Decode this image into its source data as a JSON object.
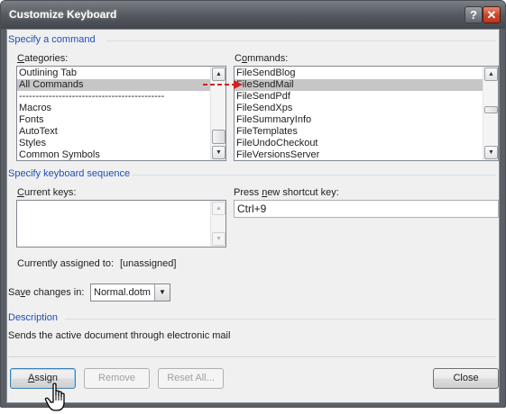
{
  "window": {
    "title": "Customize Keyboard",
    "help_label": "?",
    "close_label": "✕"
  },
  "specify_command": {
    "header": "Specify a command",
    "categories_label_pre": "",
    "categories_label_key": "C",
    "categories_label_post": "ategories:",
    "categories": [
      "Outlining Tab",
      "All Commands",
      "--------------------------------------------",
      "Macros",
      "Fonts",
      "AutoText",
      "Styles",
      "Common Symbols"
    ],
    "categories_selected_index": 1,
    "commands_label_pre": "C",
    "commands_label_key": "o",
    "commands_label_post": "mmands:",
    "commands": [
      "FileSendBlog",
      "FileSendMail",
      "FileSendPdf",
      "FileSendXps",
      "FileSummaryInfo",
      "FileTemplates",
      "FileUndoCheckout",
      "FileVersionsServer"
    ],
    "commands_selected_index": 1
  },
  "keyboard_sequence": {
    "header": "Specify keyboard sequence",
    "current_keys_label_pre": "",
    "current_keys_label_key": "C",
    "current_keys_label_post": "urrent keys:",
    "new_shortcut_label_pre": "Press ",
    "new_shortcut_label_key": "n",
    "new_shortcut_label_post": "ew shortcut key:",
    "new_shortcut_value": "Ctrl+9",
    "currently_assigned_label": "Currently assigned to:",
    "currently_assigned_value": "[unassigned]"
  },
  "save_changes": {
    "label_pre": "Sa",
    "label_key": "v",
    "label_post": "e changes in:",
    "value": "Normal.dotm"
  },
  "description": {
    "header": "Description",
    "text": "Sends the active document through electronic mail"
  },
  "buttons": {
    "assign_key": "A",
    "assign_rest": "ssign",
    "remove": "Remove",
    "reset_all": "Reset All...",
    "close": "Close"
  },
  "colors": {
    "section_header": "#1f4fb4",
    "arrow": "#d42020",
    "title_bar": "#555a60"
  },
  "icons": {
    "annotation": "arrow-right",
    "pointer": "hand-cursor"
  }
}
